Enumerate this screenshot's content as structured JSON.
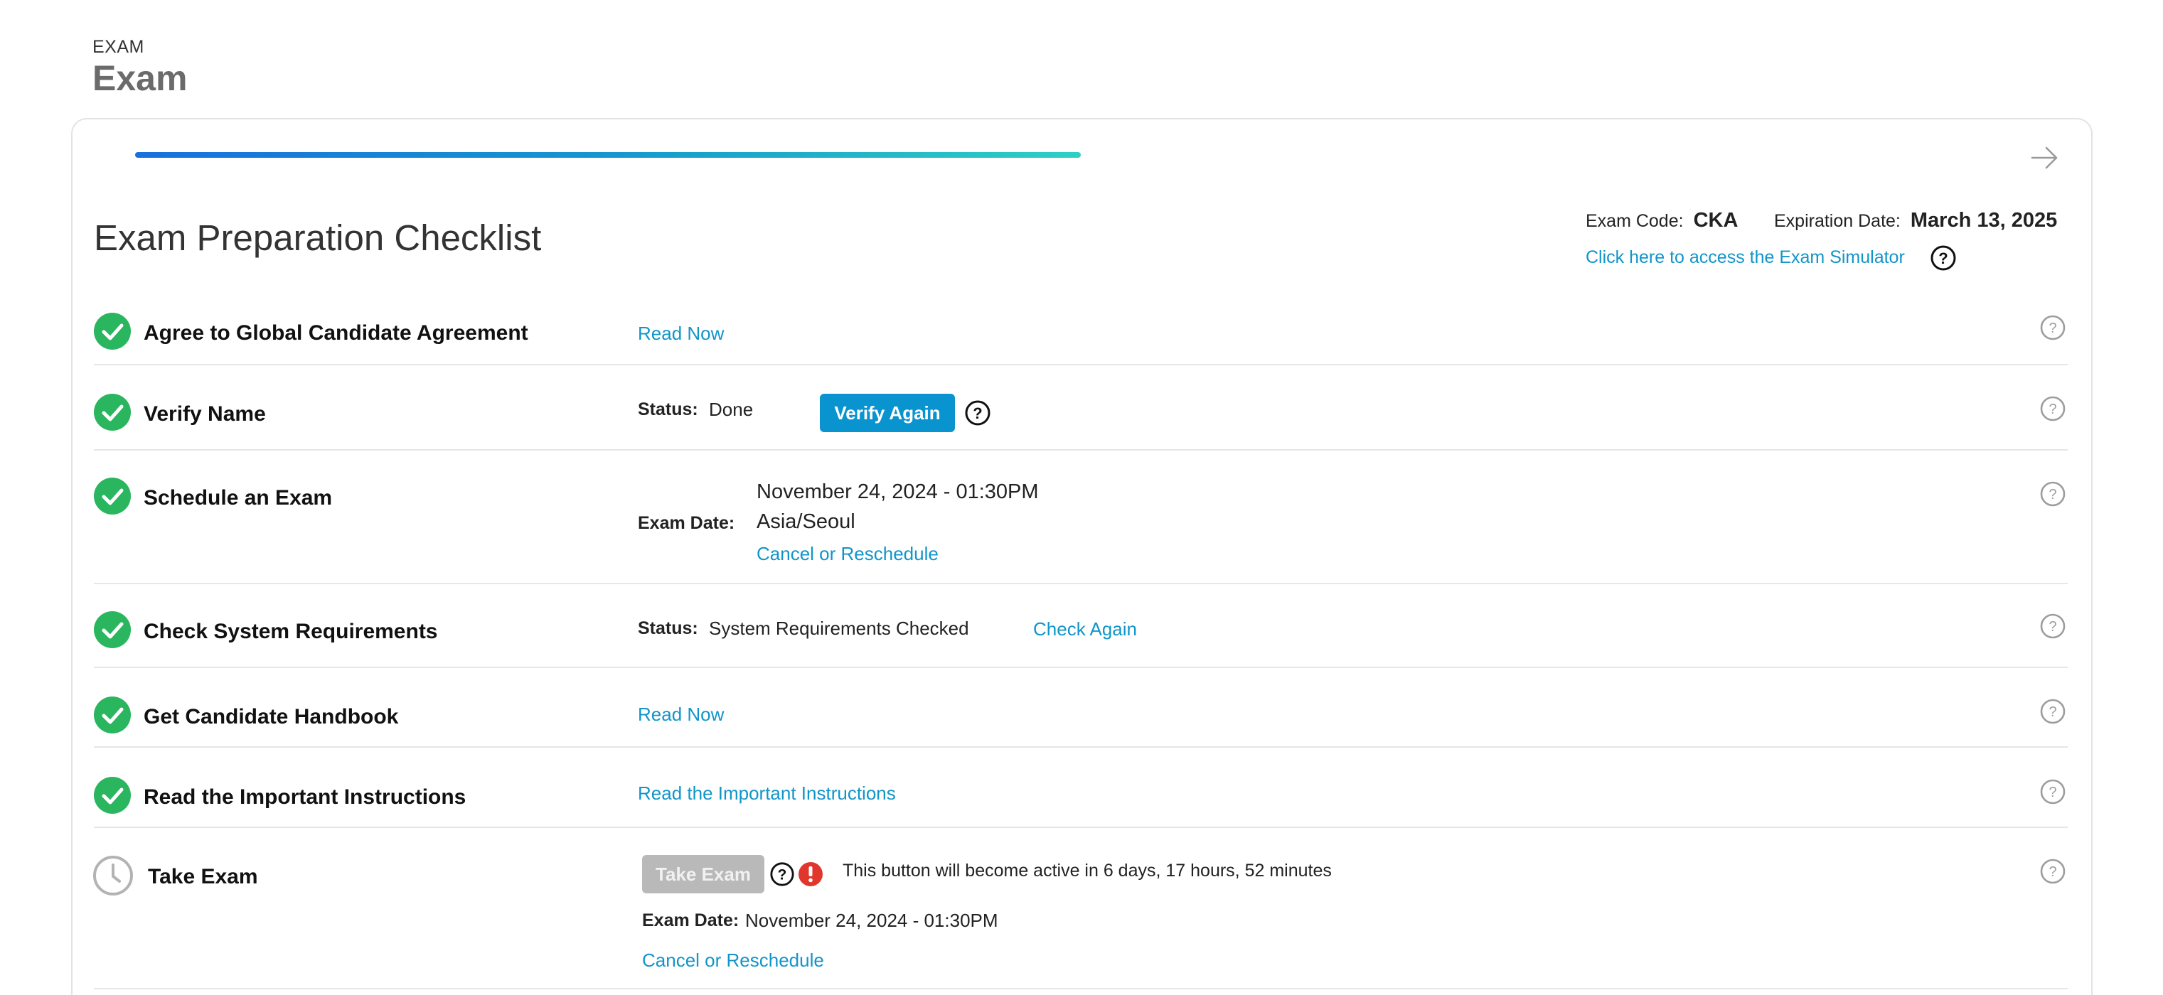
{
  "header": {
    "eyebrow": "EXAM",
    "title": "Exam"
  },
  "checklist": {
    "title": "Exam Preparation Checklist",
    "progress_fraction": 0.48
  },
  "meta": {
    "exam_code_label": "Exam Code:",
    "exam_code": "CKA",
    "expiration_label": "Expiration Date:",
    "expiration_date": "March 13, 2025",
    "simulator_link": "Click here to access the Exam Simulator"
  },
  "tasks": {
    "agreement": {
      "label": "Agree to Global Candidate Agreement",
      "link": "Read Now"
    },
    "verify_name": {
      "label": "Verify Name",
      "status_label": "Status:",
      "status": "Done",
      "button": "Verify Again"
    },
    "schedule": {
      "label": "Schedule an Exam",
      "date_label": "Exam Date:",
      "date": "November 24, 2024 - 01:30PM",
      "timezone": "Asia/Seoul",
      "link": "Cancel or Reschedule"
    },
    "system": {
      "label": "Check System Requirements",
      "status_label": "Status:",
      "status": "System Requirements Checked",
      "link": "Check Again"
    },
    "handbook": {
      "label": "Get Candidate Handbook",
      "link": "Read Now"
    },
    "instructions": {
      "label": "Read the Important Instructions",
      "link": "Read the Important Instructions"
    },
    "take_exam": {
      "label": "Take Exam",
      "button": "Take Exam",
      "notice": "This button will become active in 6 days, 17 hours, 52 minutes",
      "date_label": "Exam Date:",
      "date": "November 24, 2024 - 01:30PM",
      "link": "Cancel or Reschedule"
    }
  },
  "colors": {
    "accent": "#1195c9",
    "success": "#2ab55f",
    "warning": "#e0362c",
    "disabled": "#b9b9b9"
  }
}
